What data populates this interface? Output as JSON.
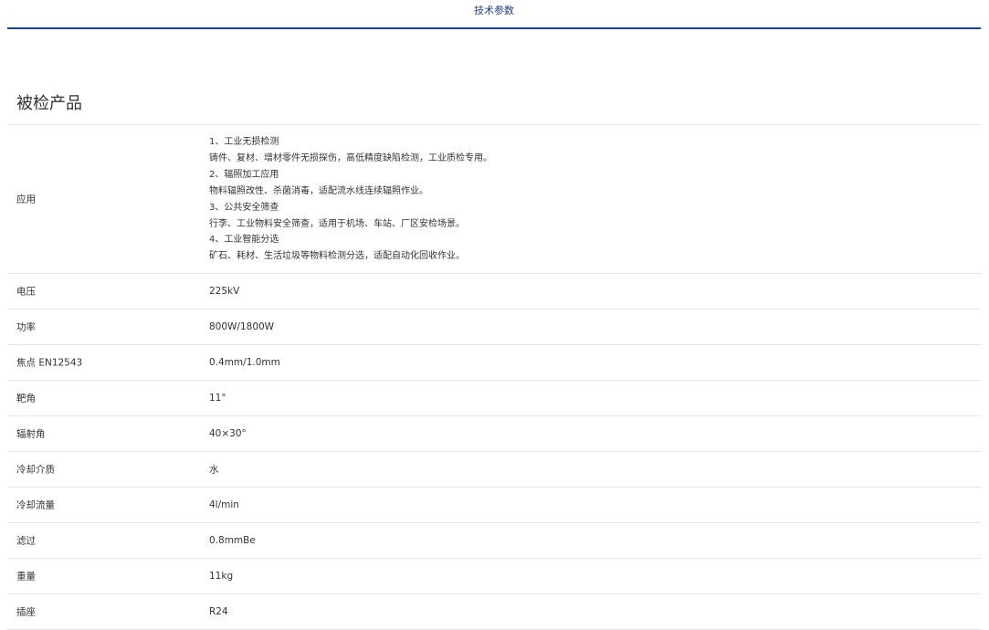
{
  "tabs": {
    "active_label": "技术参数"
  },
  "section": {
    "title": "被检产品"
  },
  "application": {
    "label": "应用",
    "lines": [
      "1、工业无损检测",
      "铸件、复材、增材零件无损探伤，高低精度缺陷检测，工业质检专用。",
      "2、辐照加工应用",
      "物料辐照改性、杀菌消毒，适配流水线连续辐照作业。",
      "3、公共安全筛查",
      "行李、工业物料安全筛查，适用于机场、车站、厂区安检场景。",
      "4、工业智能分选",
      "矿石、耗材、生活垃圾等物料检测分选，适配自动化回收作业。"
    ]
  },
  "specs": [
    {
      "label": "电压",
      "value": "225kV"
    },
    {
      "label": "功率",
      "value": "800W/1800W"
    },
    {
      "label": "焦点 EN12543",
      "value": "0.4mm/1.0mm"
    },
    {
      "label": "靶角",
      "value": "11°"
    },
    {
      "label": "辐射角",
      "value": "40×30°"
    },
    {
      "label": "冷却介质",
      "value": "水"
    },
    {
      "label": "冷却流量",
      "value": "4l/min"
    },
    {
      "label": "滤过",
      "value": "0.8mmBe"
    },
    {
      "label": "重量",
      "value": "11kg"
    },
    {
      "label": "插座",
      "value": "R24"
    }
  ],
  "colors": {
    "accent": "#1f3f86",
    "divider": "#e6e6e6",
    "text": "#333333"
  }
}
